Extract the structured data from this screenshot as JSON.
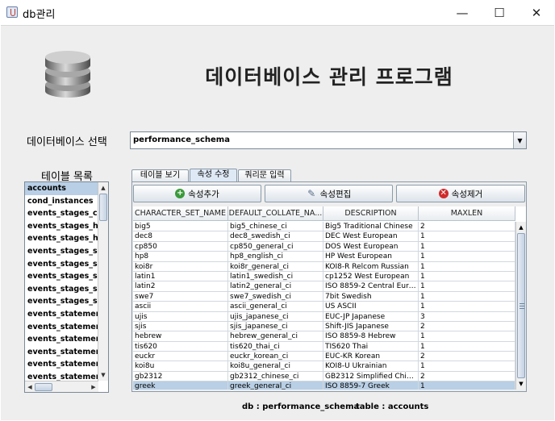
{
  "window": {
    "title": "db관리",
    "min_glyph": "—",
    "max_glyph": "☐",
    "close_glyph": "✕"
  },
  "header": {
    "logo_icon": "database-icon",
    "title": "데이터베이스 관리 프로그램"
  },
  "database": {
    "label": "데이터베이스 선택",
    "selected": "performance_schema",
    "arrow_glyph": "▼"
  },
  "tables": {
    "label": "테이블 목록",
    "items": [
      "accounts",
      "cond_instances",
      "events_stages_current",
      "events_stages_history",
      "events_stages_history_long",
      "events_stages_summary_by_account",
      "events_stages_summary_by_host",
      "events_stages_summary_by_thread",
      "events_stages_summary_by_user",
      "events_stages_summary_global",
      "events_statements_current",
      "events_statements_history",
      "events_statements_history_long",
      "events_statements_summary",
      "events_statements_summary_by_host",
      "events_statements_summary_by_thread"
    ],
    "selected_index": 0
  },
  "tabs": [
    {
      "label": "테이블 보기"
    },
    {
      "label": "속성 수정"
    },
    {
      "label": "쿼리문 입력"
    }
  ],
  "active_tab": 1,
  "actions": {
    "add_label": "속성추가",
    "edit_label": "속성편집",
    "delete_label": "속성제거",
    "add_glyph": "+",
    "edit_glyph": "✎",
    "delete_glyph": "✕"
  },
  "grid": {
    "columns": [
      "CHARACTER_SET_NAME",
      "DEFAULT_COLLATE_NA...",
      "DESCRIPTION",
      "MAXLEN"
    ],
    "rows": [
      [
        "big5",
        "big5_chinese_ci",
        "Big5 Traditional Chinese",
        "2"
      ],
      [
        "dec8",
        "dec8_swedish_ci",
        "DEC West European",
        "1"
      ],
      [
        "cp850",
        "cp850_general_ci",
        "DOS West European",
        "1"
      ],
      [
        "hp8",
        "hp8_english_ci",
        "HP West European",
        "1"
      ],
      [
        "koi8r",
        "koi8r_general_ci",
        "KOI8-R Relcom Russian",
        "1"
      ],
      [
        "latin1",
        "latin1_swedish_ci",
        "cp1252 West European",
        "1"
      ],
      [
        "latin2",
        "latin2_general_ci",
        "ISO 8859-2 Central Euro...",
        "1"
      ],
      [
        "swe7",
        "swe7_swedish_ci",
        "7bit Swedish",
        "1"
      ],
      [
        "ascii",
        "ascii_general_ci",
        "US ASCII",
        "1"
      ],
      [
        "ujis",
        "ujis_japanese_ci",
        "EUC-JP Japanese",
        "3"
      ],
      [
        "sjis",
        "sjis_japanese_ci",
        "Shift-JIS Japanese",
        "2"
      ],
      [
        "hebrew",
        "hebrew_general_ci",
        "ISO 8859-8 Hebrew",
        "1"
      ],
      [
        "tis620",
        "tis620_thai_ci",
        "TIS620 Thai",
        "1"
      ],
      [
        "euckr",
        "euckr_korean_ci",
        "EUC-KR Korean",
        "2"
      ],
      [
        "koi8u",
        "koi8u_general_ci",
        "KOI8-U Ukrainian",
        "1"
      ],
      [
        "gb2312",
        "gb2312_chinese_ci",
        "GB2312 Simplified Chine...",
        "2"
      ],
      [
        "greek",
        "greek_general_ci",
        "ISO 8859-7 Greek",
        "1"
      ]
    ],
    "selected_index": 16
  },
  "scroll": {
    "up_glyph": "▲",
    "down_glyph": "▼",
    "left_glyph": "◀",
    "right_glyph": "▶"
  },
  "status": {
    "db_text": "db : performance_schema",
    "table_text": "table : accounts"
  },
  "colors": {
    "selection": "#b8cfe5",
    "add_icon": "#3a9a3a",
    "delete_icon": "#d02b2b"
  }
}
